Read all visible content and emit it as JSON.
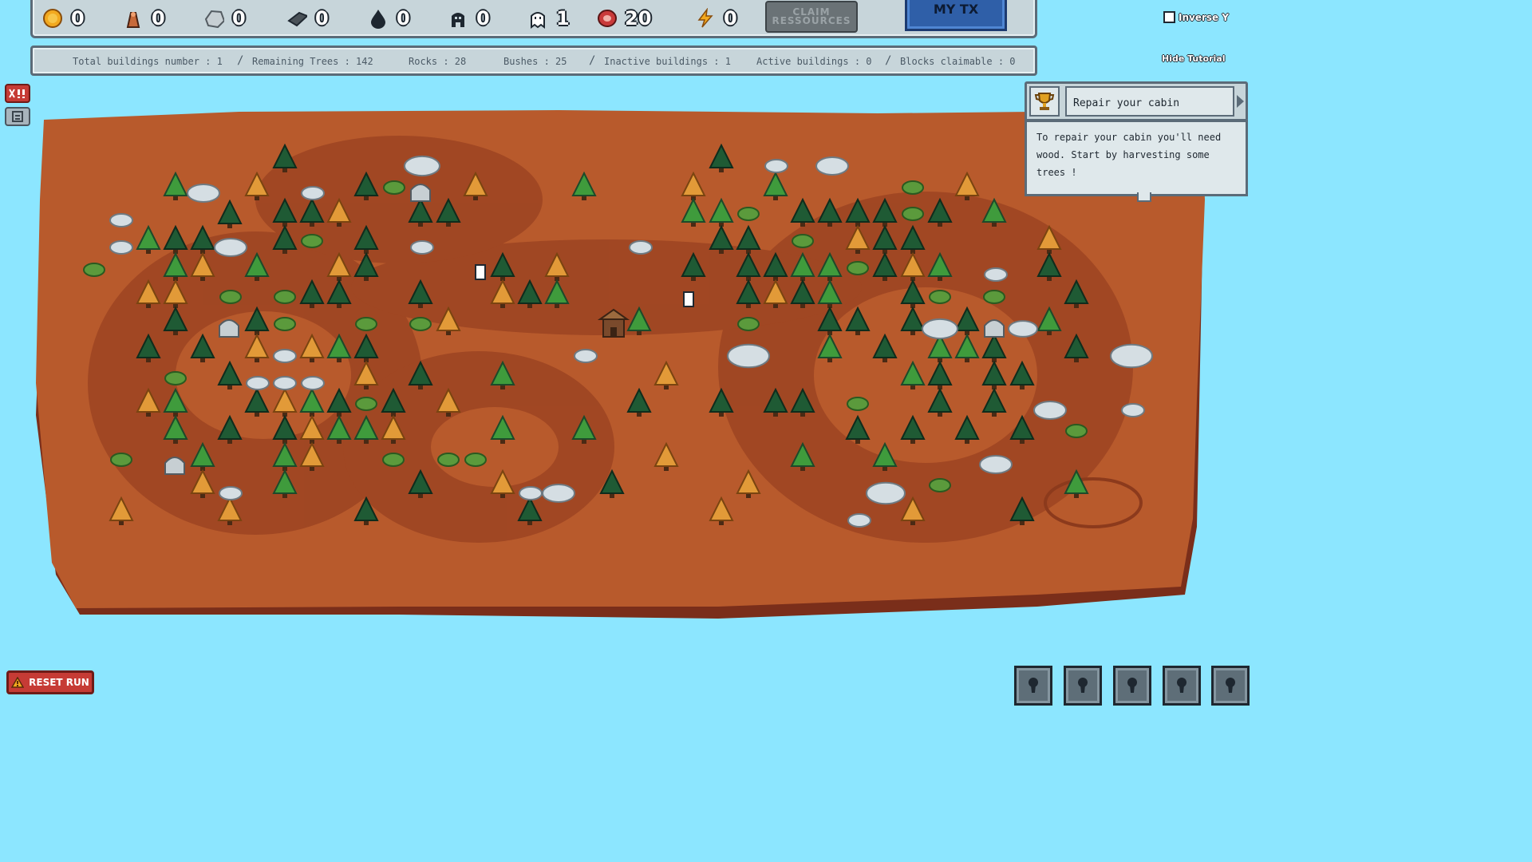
{
  "resources": [
    {
      "icon": "gold-coin-icon",
      "value": "0"
    },
    {
      "icon": "wood-log-icon",
      "value": "0"
    },
    {
      "icon": "stone-icon",
      "value": "0"
    },
    {
      "icon": "iron-ingot-icon",
      "value": "0"
    },
    {
      "icon": "oil-drop-icon",
      "value": "0"
    },
    {
      "icon": "worker-icon",
      "value": "0"
    },
    {
      "icon": "ghost-icon",
      "value": "1"
    },
    {
      "icon": "meat-icon",
      "value": "20"
    },
    {
      "icon": "energy-bolt-icon",
      "value": "0"
    }
  ],
  "toolbar": {
    "claim_label": "CLAIM RESSOURCES",
    "mytx_label": "MY TX"
  },
  "stats": {
    "total_buildings": "Total buildings number : 1",
    "remaining_trees": "Remaining Trees : 142",
    "rocks": "Rocks : 28",
    "bushes": "Bushes : 25",
    "inactive_buildings": "Inactive buildings : 1",
    "active_buildings": "Active buildings : 0",
    "blocks_claimable": "Blocks claimable : 0",
    "separator": "/"
  },
  "controls": {
    "inverse_label": "Inverse Y",
    "hide_tutorial": "Hide Tutorial",
    "reset_label": "RESET RUN"
  },
  "quest": {
    "title": "Repair your cabin",
    "body": "To repair your cabin you'll need wood. Start by harvesting some trees !"
  },
  "colors": {
    "water": "#8ce6ff",
    "dirt": "#b85a2c",
    "dirt_dark": "#9c4422",
    "tree_green": "#3f9b3c",
    "tree_dark": "#1f5a34",
    "tree_orange": "#e29a38",
    "rock": "#d5dee3"
  }
}
